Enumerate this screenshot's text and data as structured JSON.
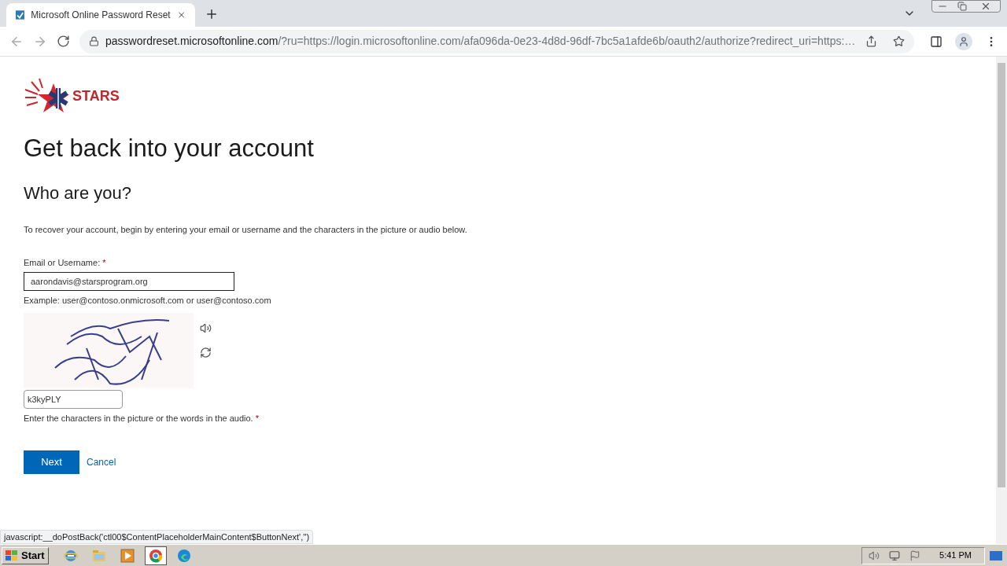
{
  "browser": {
    "tabs": [
      {
        "title": "Microsoft Online Password Reset",
        "selected": true
      }
    ],
    "address": {
      "host": "passwordreset.microsoftonline.com",
      "path": "/?ru=https://login.microsoftonline.com/afa096da-0e23-4d8d-96df-7bc5a1afde6b/oauth2/authorize?redirect_uri=https:…"
    }
  },
  "page": {
    "logo_text": "STARS",
    "title": "Get back into your account",
    "subtitle": "Who are you?",
    "intro": "To recover your account, begin by entering your email or username and the characters in the picture or audio below.",
    "email": {
      "label": "Email or Username:",
      "required_mark": "*",
      "value": "aarondavis@starsprogram.org",
      "example": "Example: user@contoso.onmicrosoft.com or user@contoso.com"
    },
    "captcha": {
      "kind": "picture",
      "value": "k3kyPLY",
      "hint": "Enter the characters in the picture or the words in the audio.",
      "required_mark": "*"
    },
    "buttons": {
      "primary": "Next",
      "secondary": "Cancel"
    }
  },
  "status_link": "javascript:__doPostBack('ctl00$ContentPlaceholderMainContent$ButtonNext','')",
  "taskbar": {
    "start": "Start",
    "apps": [
      {
        "kind": "ie",
        "selected": false
      },
      {
        "kind": "folder",
        "selected": false
      },
      {
        "kind": "media",
        "selected": false
      },
      {
        "kind": "chrome",
        "selected": true
      },
      {
        "kind": "edge",
        "selected": false
      }
    ],
    "time": "5:41 PM"
  }
}
